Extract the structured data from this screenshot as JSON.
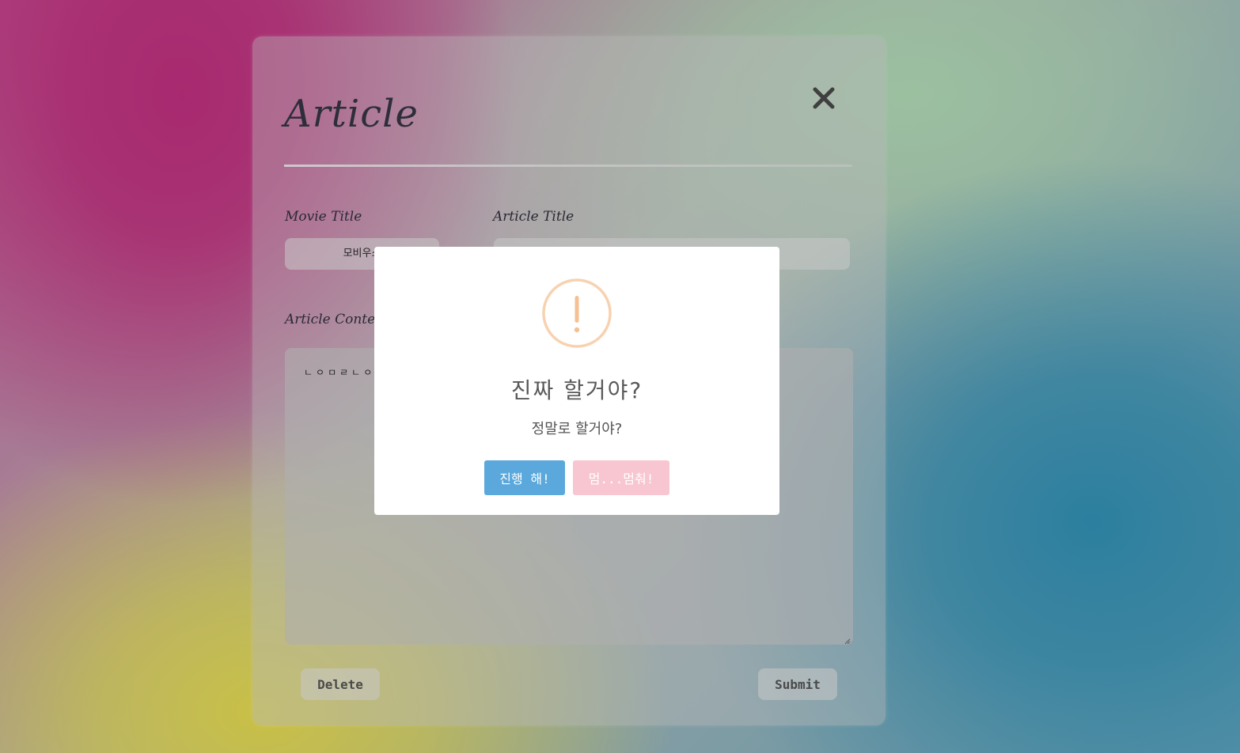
{
  "article_form": {
    "heading": "Article",
    "close_icon": "close-icon",
    "movie_title_label": "Movie Title",
    "movie_title_value": "모비우스",
    "article_title_label": "Article Title",
    "article_title_value": "",
    "article_content_label": "Article Content",
    "article_content_value": "ㄴㅇㅁㄹㄴㅇ",
    "delete_label": "Delete",
    "submit_label": "Submit"
  },
  "confirm_dialog": {
    "icon": "warning-icon",
    "title": "진짜 할거야?",
    "text": "정말로 할거야?",
    "confirm_label": "진행 해!",
    "cancel_label": "멈...멈춰!",
    "colors": {
      "confirm": "#5aa8dc",
      "cancel": "#f8c6d0",
      "warning": "#f8c8a0"
    }
  }
}
